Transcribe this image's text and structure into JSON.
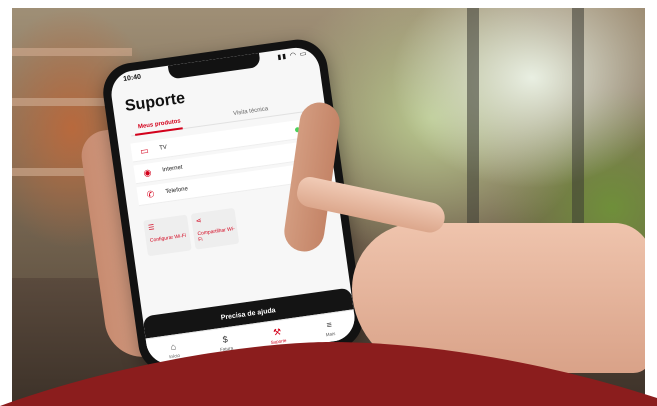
{
  "colors": {
    "brand_red": "#d3001b",
    "wave_red": "#8b1d1d",
    "status_green": "#4bd25b",
    "phone_black": "#121212"
  },
  "status_bar": {
    "time": "10:40"
  },
  "screen": {
    "title": "Suporte",
    "tabs": [
      {
        "label": "Meus produtos",
        "active": true
      },
      {
        "label": "Visita técnica",
        "active": false
      }
    ],
    "products": [
      {
        "label": "TV",
        "icon": "tv-icon"
      },
      {
        "label": "Internet",
        "icon": "globe-icon"
      },
      {
        "label": "Telefone",
        "icon": "phone-icon"
      }
    ],
    "actions": [
      {
        "label": "Configurar Wi-Fi",
        "icon": "settings-icon"
      },
      {
        "label": "Compartilhar Wi-Fi",
        "icon": "share-icon"
      }
    ],
    "help_label": "Precisa de ajuda",
    "bottom_nav": [
      {
        "label": "Início",
        "icon": "home-icon",
        "active": false
      },
      {
        "label": "Fatura",
        "icon": "dollar-icon",
        "active": false
      },
      {
        "label": "Suporte",
        "icon": "wrench-icon",
        "active": true
      },
      {
        "label": "Mais",
        "icon": "menu-icon",
        "active": false
      }
    ]
  }
}
